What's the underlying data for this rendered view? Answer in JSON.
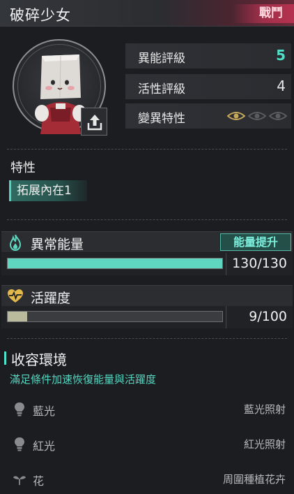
{
  "header": {
    "title": "破碎少女",
    "badge": "戰鬥"
  },
  "stats": [
    {
      "label": "異能評級",
      "value": "5"
    },
    {
      "label": "活性評級",
      "value": "4"
    },
    {
      "label": "變異特性",
      "value": ""
    }
  ],
  "mutation_eyes": {
    "active": 1,
    "total": 3
  },
  "traits": {
    "title": "特性",
    "items": [
      "拓展內在1"
    ]
  },
  "energy": {
    "label": "異常能量",
    "button": "能量提升",
    "value_text": "130/130",
    "current": 130,
    "max": 130,
    "color": "#5ed6c0"
  },
  "vitality": {
    "label": "活躍度",
    "value_text": "9/100",
    "current": 9,
    "max": 100,
    "color": "#b9bb9c"
  },
  "environment": {
    "title": "收容環境",
    "subtitle": "滿足條件加速恢復能量與活躍度",
    "rows": [
      {
        "icon": "lightbulb-icon",
        "name": "藍光",
        "condition": "藍光照射"
      },
      {
        "icon": "lightbulb-icon",
        "name": "紅光",
        "condition": "紅光照射"
      },
      {
        "icon": "sprout-icon",
        "name": "花",
        "condition": "周圍種植花卉"
      }
    ]
  },
  "colors": {
    "accent": "#4fe0c8",
    "combat": "#b4324f"
  }
}
